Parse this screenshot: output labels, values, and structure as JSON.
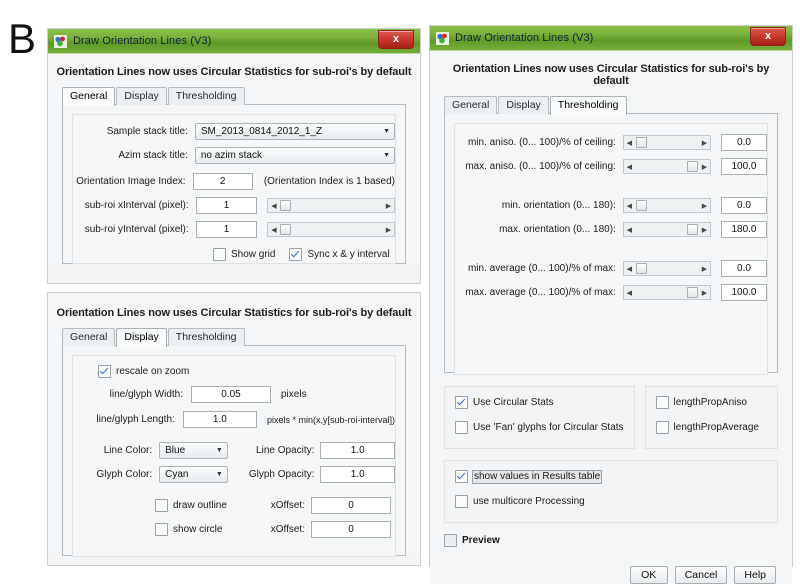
{
  "figure": {
    "panel_label": "B"
  },
  "window_left_top": {
    "title": "Draw Orientation Lines (V3)",
    "close_label": "x",
    "banner": "Orientation Lines now uses Circular Statistics for sub-roi's by default",
    "tabs": [
      {
        "label": "General",
        "active": true
      },
      {
        "label": "Display",
        "active": false
      },
      {
        "label": "Thresholding",
        "active": false
      }
    ],
    "fields": {
      "sample_stack_title_label": "Sample stack title:",
      "sample_stack_title_value": "SM_2013_0814_2012_1_Z",
      "azim_stack_title_label": "Azim stack title:",
      "azim_stack_title_value": "no azim stack",
      "orientation_image_index_label": "Orientation Image Index:",
      "orientation_image_index_value": "2",
      "orientation_index_note": "(Orientation Index is 1 based)",
      "sub_roi_x_label": "sub-roi xInterval (pixel):",
      "sub_roi_x_value": "1",
      "sub_roi_y_label": "sub-roi yInterval (pixel):",
      "sub_roi_y_value": "1"
    },
    "checkboxes": [
      {
        "label": "Show grid",
        "checked": false
      },
      {
        "label": "Sync x & y interval",
        "checked": true
      }
    ]
  },
  "window_left_bottom": {
    "banner": "Orientation Lines now uses Circular Statistics for sub-roi's by default",
    "tabs": [
      {
        "label": "General",
        "active": false
      },
      {
        "label": "Display",
        "active": true
      },
      {
        "label": "Thresholding",
        "active": false
      }
    ],
    "rescale_on_zoom": {
      "label": "rescale on zoom",
      "checked": true
    },
    "fields": {
      "line_glyph_width_label": "line/glyph Width:",
      "line_glyph_width_value": "0.05",
      "line_glyph_width_unit": "pixels",
      "line_glyph_length_label": "line/glyph Length:",
      "line_glyph_length_value": "1.0",
      "line_glyph_length_unit": "pixels * min(x,y[sub-roi-interval])",
      "line_color_label": "Line Color:",
      "line_color_value": "Blue",
      "line_opacity_label": "Line Opacity:",
      "line_opacity_value": "1.0",
      "glyph_color_label": "Glyph Color:",
      "glyph_color_value": "Cyan",
      "glyph_opacity_label": "Glyph Opacity:",
      "glyph_opacity_value": "1.0",
      "draw_outline_label": "draw outline",
      "draw_outline_checked": false,
      "x_offset_1_label": "xOffset:",
      "x_offset_1_value": "0",
      "show_circle_label": "show circle",
      "show_circle_checked": false,
      "x_offset_2_label": "xOffset:",
      "x_offset_2_value": "0"
    }
  },
  "window_right": {
    "title": "Draw Orientation Lines (V3)",
    "close_label": "x",
    "banner": "Orientation Lines now uses Circular Statistics for sub-roi's by default",
    "tabs": [
      {
        "label": "General",
        "active": false
      },
      {
        "label": "Display",
        "active": false
      },
      {
        "label": "Thresholding",
        "active": true
      }
    ],
    "thresholds": [
      {
        "label": "min. aniso. (0... 100)/% of ceiling:",
        "value": "0.0",
        "thumb_pct": 0
      },
      {
        "label": "max. aniso. (0... 100)/% of ceiling:",
        "value": "100.0",
        "thumb_pct": 100
      },
      {
        "label": "min. orientation (0... 180):",
        "value": "0.0",
        "thumb_pct": 0
      },
      {
        "label": "max. orientation (0... 180):",
        "value": "180.0",
        "thumb_pct": 100
      },
      {
        "label": "min. average (0... 100)/% of max:",
        "value": "0.0",
        "thumb_pct": 0
      },
      {
        "label": "max. average (0... 100)/% of max:",
        "value": "100.0",
        "thumb_pct": 100
      }
    ],
    "options_group_a": [
      {
        "label": "Use Circular Stats",
        "checked": true
      },
      {
        "label": "Use 'Fan' glyphs for Circular Stats",
        "checked": false
      }
    ],
    "options_group_b": [
      {
        "label": "lengthPropAniso",
        "checked": false
      },
      {
        "label": "lengthPropAverage",
        "checked": false
      }
    ],
    "options_group_c": [
      {
        "label": "show values in Results table",
        "checked": true,
        "selected": true
      },
      {
        "label": "use multicore Processing",
        "checked": false,
        "selected": false
      }
    ],
    "preview": {
      "label": "Preview",
      "checked": false
    },
    "buttons": [
      {
        "label": "OK"
      },
      {
        "label": "Cancel"
      },
      {
        "label": "Help"
      }
    ]
  }
}
